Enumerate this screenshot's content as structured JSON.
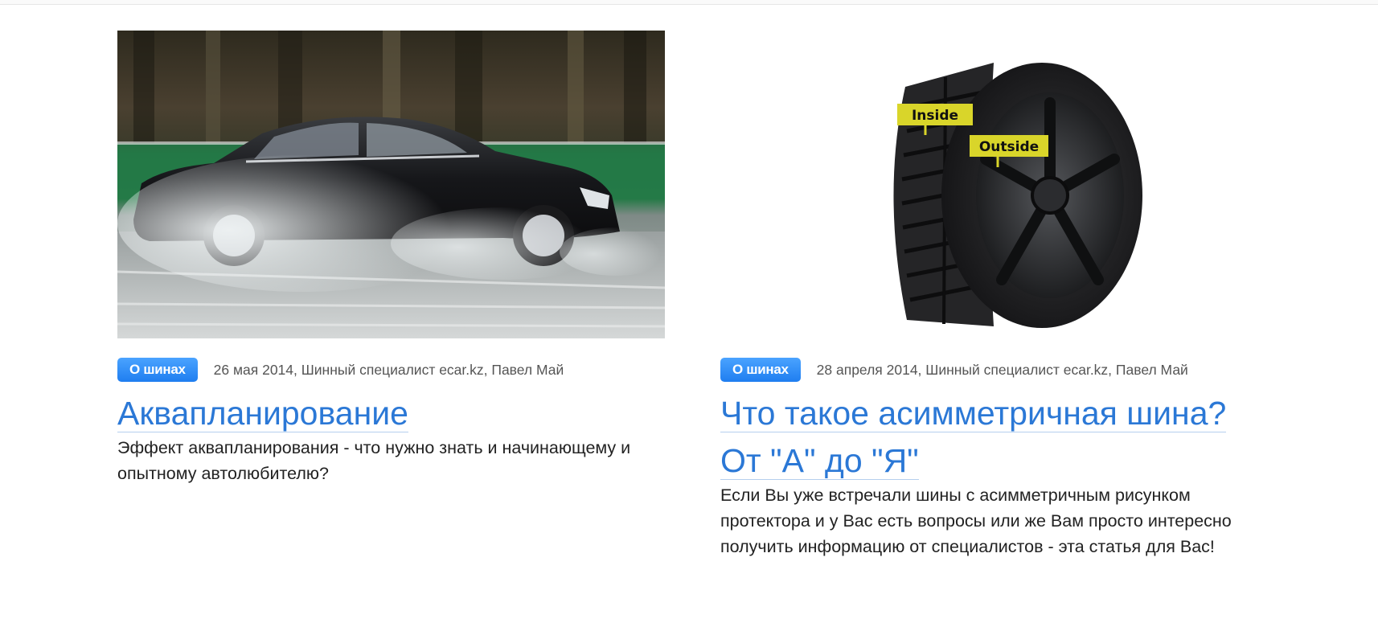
{
  "articles": [
    {
      "category": "О шинах",
      "meta": "26 мая 2014, Шинный специалист ecar.kz, Павел Май",
      "title": "Аквапланирование",
      "excerpt": "Эффект аквапланирования - что нужно знать и начинающему и опытному автолюбителю?",
      "image_icon": "car-hydroplaning-photo"
    },
    {
      "category": "О шинах",
      "meta": "28 апреля 2014, Шинный специалист ecar.kz, Павел Май",
      "title_line1": "Что такое асимметричная шина?",
      "title_line2": "От \"А\" до \"Я\"",
      "excerpt": "Если Вы уже встречали шины с асимметричным рисунком протектора и у Вас есть вопросы или же Вам просто интересно получить информацию от специалистов - эта статья для Вас!",
      "image_icon": "asymmetric-tire-photo",
      "image_labels": {
        "inside": "Inside",
        "outside": "Outside"
      }
    }
  ],
  "colors": {
    "link": "#2b78d6",
    "badge": "#1f7ef0",
    "meta": "#555555",
    "text": "#222222"
  }
}
